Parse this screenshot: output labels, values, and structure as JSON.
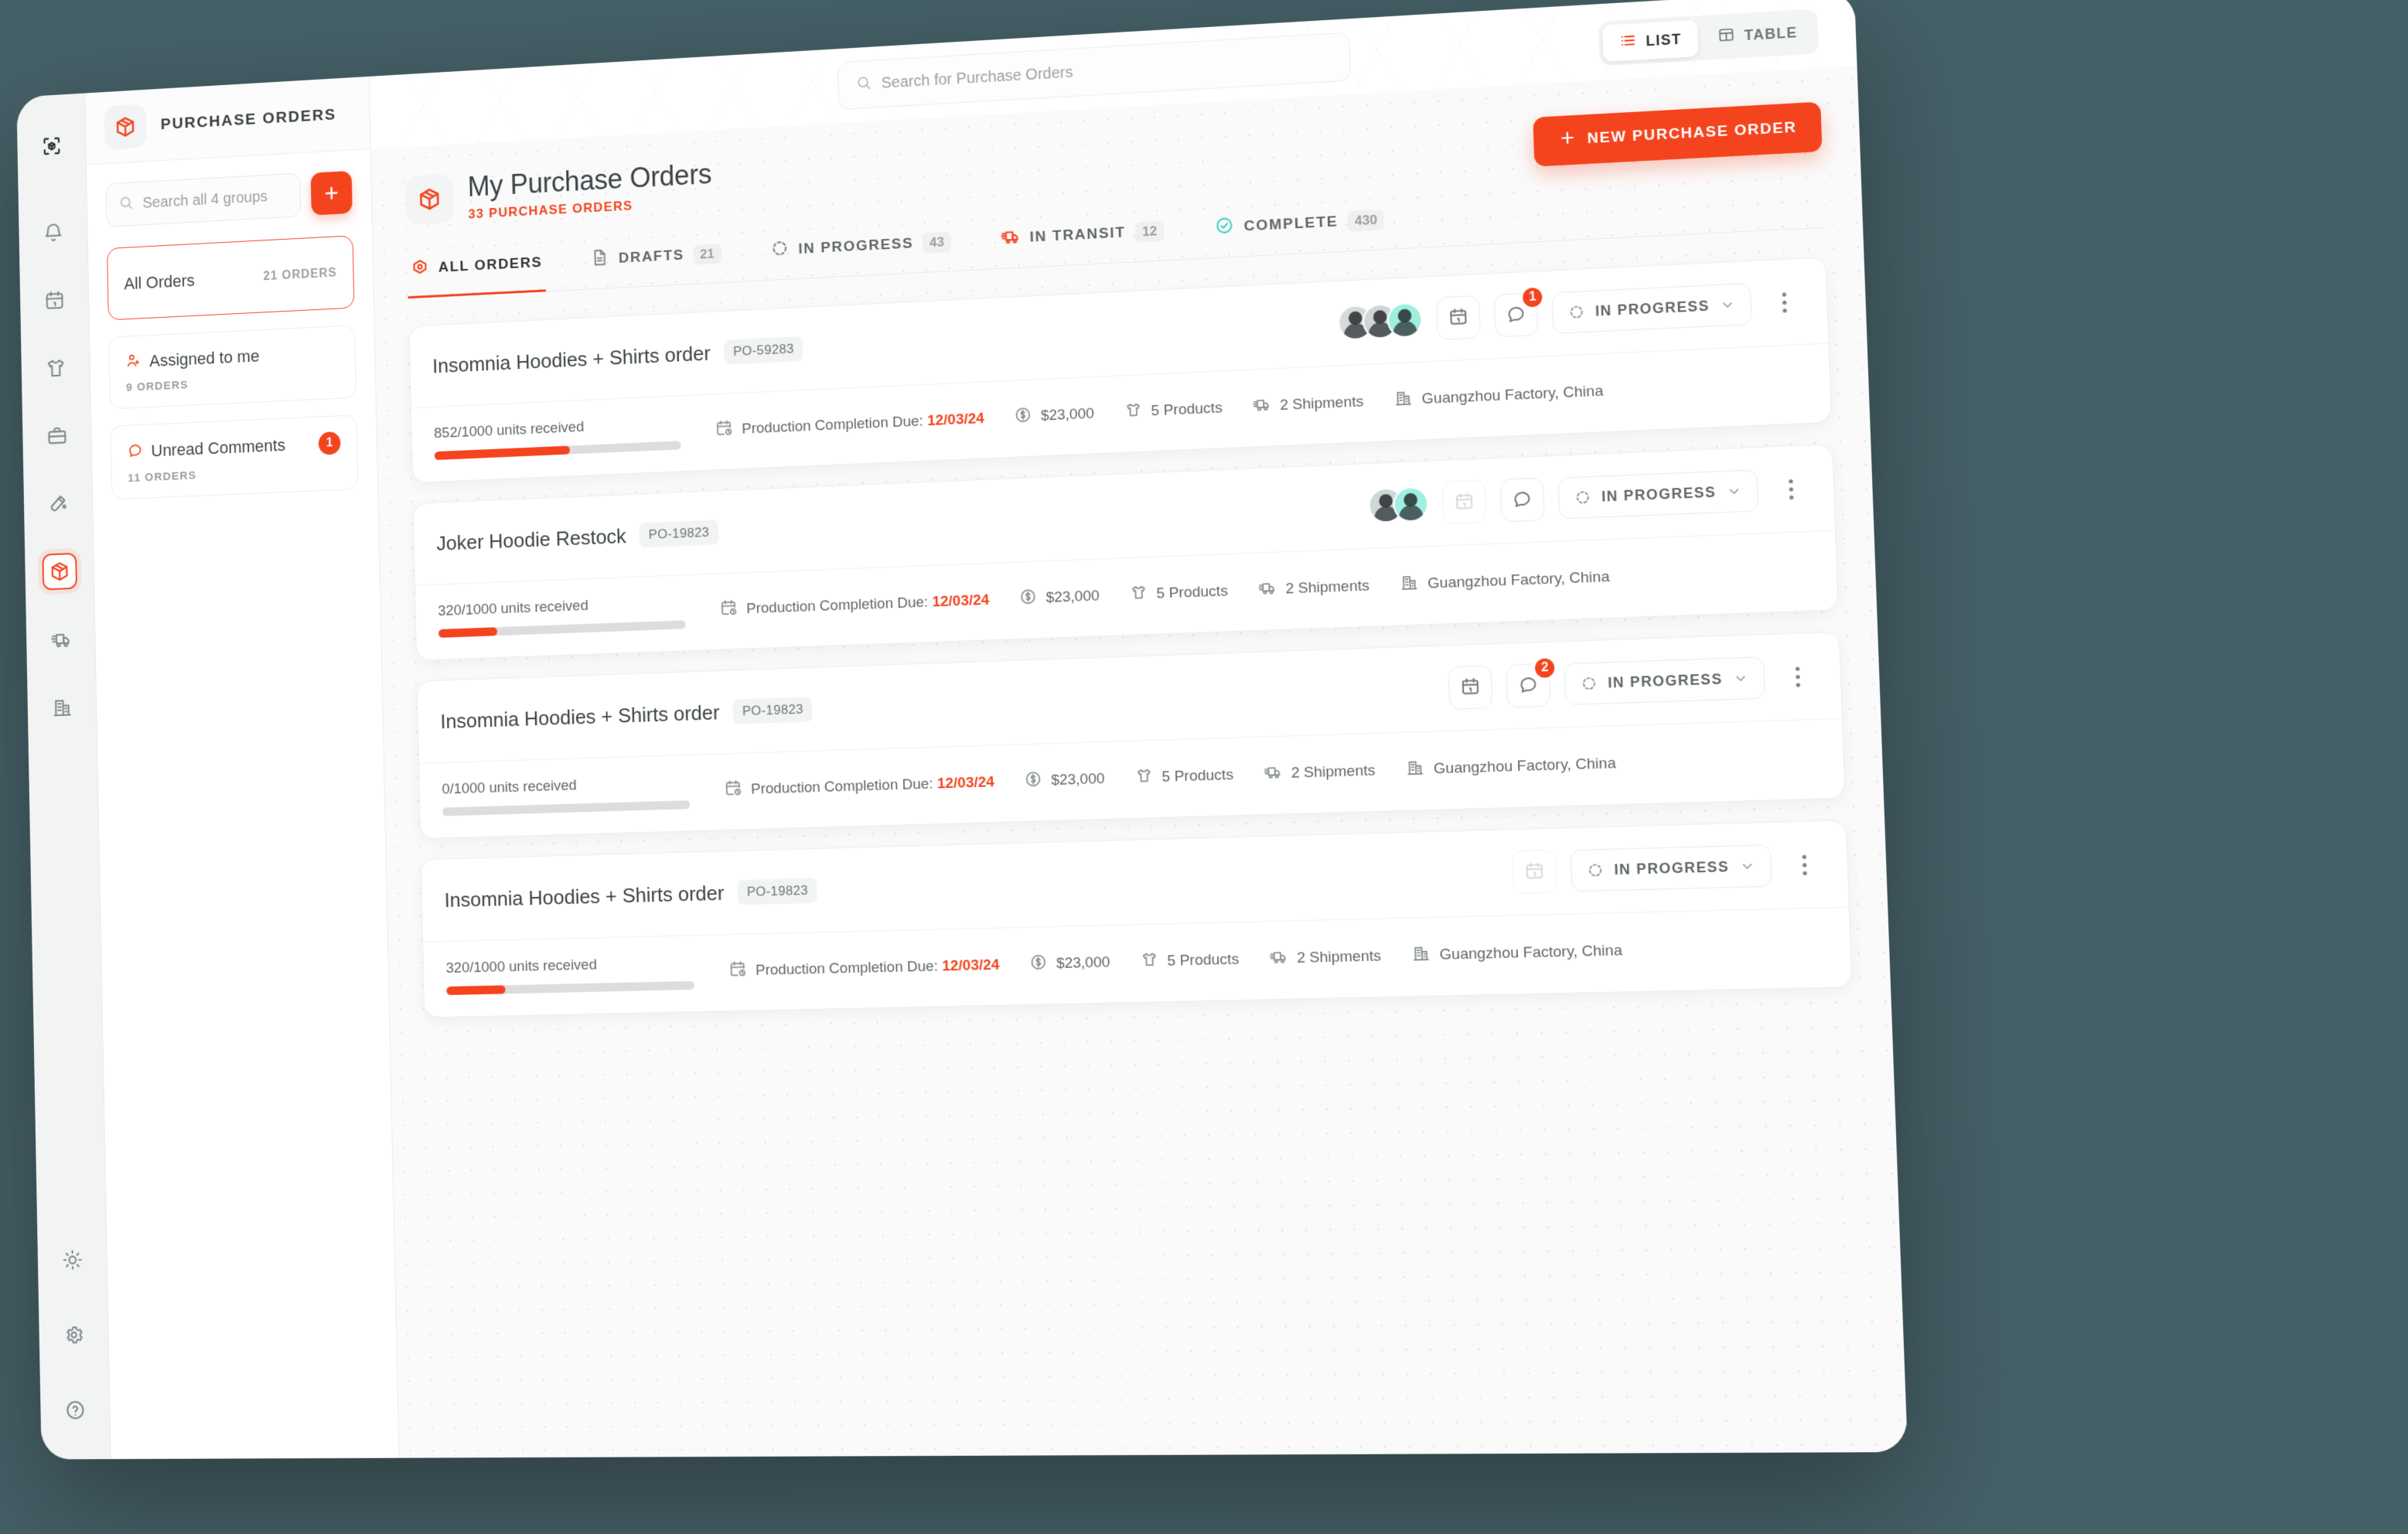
{
  "accent": "#f4441e",
  "background": "#456067",
  "rail": {
    "top": [
      {
        "name": "app-logo",
        "icon": "cube-scan-icon"
      },
      {
        "name": "notifications",
        "icon": "bell-icon"
      },
      {
        "name": "calendar",
        "icon": "calendar-icon"
      },
      {
        "name": "products",
        "icon": "tshirt-icon"
      },
      {
        "name": "workspace",
        "icon": "briefcase-icon"
      },
      {
        "name": "samples",
        "icon": "test-tube-icon"
      },
      {
        "name": "purchase-orders",
        "icon": "package-icon",
        "active": true
      },
      {
        "name": "shipments",
        "icon": "truck-icon"
      },
      {
        "name": "factories",
        "icon": "building-icon"
      }
    ],
    "bottom": [
      {
        "name": "theme",
        "icon": "sun-icon"
      },
      {
        "name": "settings",
        "icon": "gear-icon"
      },
      {
        "name": "help",
        "icon": "help-circle-icon"
      }
    ]
  },
  "sidebar": {
    "header_title": "PURCHASE ORDERS",
    "search_placeholder": "Search all 4 groups",
    "search_value": "",
    "add_label": "+",
    "groups": [
      {
        "name": "All Orders",
        "count": "21 ORDERS",
        "selected": true,
        "icon": null,
        "badge": null,
        "sub": null
      },
      {
        "name": "Assigned to me",
        "sub": "9 ORDERS",
        "icon": "user-plus-icon",
        "selected": false,
        "badge": null,
        "count": null
      },
      {
        "name": "Unread Comments",
        "sub": "11 ORDERS",
        "icon": "comment-icon",
        "selected": false,
        "badge": "1",
        "count": null
      }
    ]
  },
  "topbar": {
    "search_placeholder": "Search for Purchase Orders",
    "search_value": "",
    "views": [
      {
        "label": "LIST",
        "icon": "list-icon",
        "active": true
      },
      {
        "label": "TABLE",
        "icon": "table-icon",
        "active": false
      }
    ]
  },
  "page": {
    "title": "My Purchase Orders",
    "subtitle": "33 PURCHASE ORDERS",
    "new_button": "NEW PURCHASE ORDER"
  },
  "tabs": [
    {
      "label": "ALL ORDERS",
      "count": "",
      "icon": "eye-icon",
      "active": true
    },
    {
      "label": "DRAFTS",
      "count": "21",
      "icon": "document-icon",
      "active": false
    },
    {
      "label": "IN PROGRESS",
      "count": "43",
      "icon": "dashed-circle-icon",
      "active": false
    },
    {
      "label": "IN TRANSIT",
      "count": "12",
      "icon": "truck-icon",
      "active": false
    },
    {
      "label": "COMPLETE",
      "count": "430",
      "icon": "check-circle-icon",
      "active": false
    }
  ],
  "orders": [
    {
      "title": "Insomnia Hoodies + Shirts order",
      "po": "PO-59283",
      "avatars": 3,
      "calendar_muted": false,
      "has_comment_button": true,
      "comment_count": "1",
      "status": "IN PROGRESS",
      "progress_label": "852/1000 units received",
      "progress_pct": 55,
      "due_label": "Production Completion Due:",
      "due_date": "12/03/24",
      "amount": "$23,000",
      "products": "5 Products",
      "shipments": "2 Shipments",
      "factory": "Guangzhou Factory, China"
    },
    {
      "title": "Joker Hoodie Restock",
      "po": "PO-19823",
      "avatars": 2,
      "calendar_muted": true,
      "has_comment_button": true,
      "comment_count": "",
      "status": "IN PROGRESS",
      "progress_label": "320/1000 units received",
      "progress_pct": 24,
      "due_label": "Production Completion Due:",
      "due_date": "12/03/24",
      "amount": "$23,000",
      "products": "5 Products",
      "shipments": "2 Shipments",
      "factory": "Guangzhou Factory, China"
    },
    {
      "title": "Insomnia Hoodies + Shirts order",
      "po": "PO-19823",
      "avatars": 0,
      "calendar_muted": false,
      "has_comment_button": true,
      "comment_count": "2",
      "status": "IN PROGRESS",
      "progress_label": "0/1000 units received",
      "progress_pct": 0,
      "due_label": "Production Completion Due:",
      "due_date": "12/03/24",
      "amount": "$23,000",
      "products": "5 Products",
      "shipments": "2 Shipments",
      "factory": "Guangzhou Factory, China"
    },
    {
      "title": "Insomnia Hoodies + Shirts order",
      "po": "PO-19823",
      "avatars": 0,
      "calendar_muted": true,
      "has_comment_button": false,
      "comment_count": "",
      "status": "IN PROGRESS",
      "progress_label": "320/1000 units received",
      "progress_pct": 24,
      "due_label": "Production Completion Due:",
      "due_date": "12/03/24",
      "amount": "$23,000",
      "products": "5 Products",
      "shipments": "2 Shipments",
      "factory": "Guangzhou Factory, China"
    }
  ]
}
